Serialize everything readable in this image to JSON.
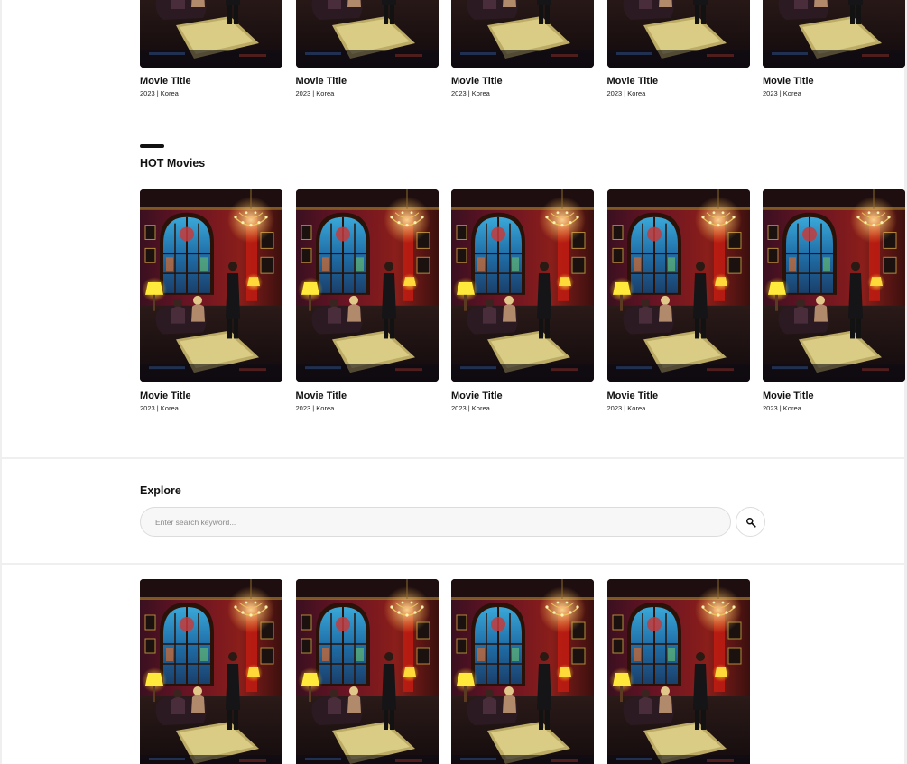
{
  "top_row": {
    "cards": [
      {
        "title": "Movie Title",
        "meta": "2023 | Korea"
      },
      {
        "title": "Movie Title",
        "meta": "2023 | Korea"
      },
      {
        "title": "Movie Title",
        "meta": "2023 | Korea"
      },
      {
        "title": "Movie Title",
        "meta": "2023 | Korea"
      },
      {
        "title": "Movie Title",
        "meta": "2023 | Korea"
      }
    ]
  },
  "hot_movies": {
    "heading": "HOT Movies",
    "cards": [
      {
        "title": "Movie Title",
        "meta": "2023 | Korea"
      },
      {
        "title": "Movie Title",
        "meta": "2023 | Korea"
      },
      {
        "title": "Movie Title",
        "meta": "2023 | Korea"
      },
      {
        "title": "Movie Title",
        "meta": "2023 | Korea"
      },
      {
        "title": "Movie Title",
        "meta": "2023 | Korea"
      }
    ]
  },
  "explore": {
    "heading": "Explore",
    "search_placeholder": "Enter search keyword...",
    "search_value": "",
    "search_icon": "search-icon"
  },
  "results": {
    "poster_count": 4
  },
  "colors": {
    "text": "#111111",
    "divider": "#efefef",
    "search_bg": "#f7f7f7"
  }
}
